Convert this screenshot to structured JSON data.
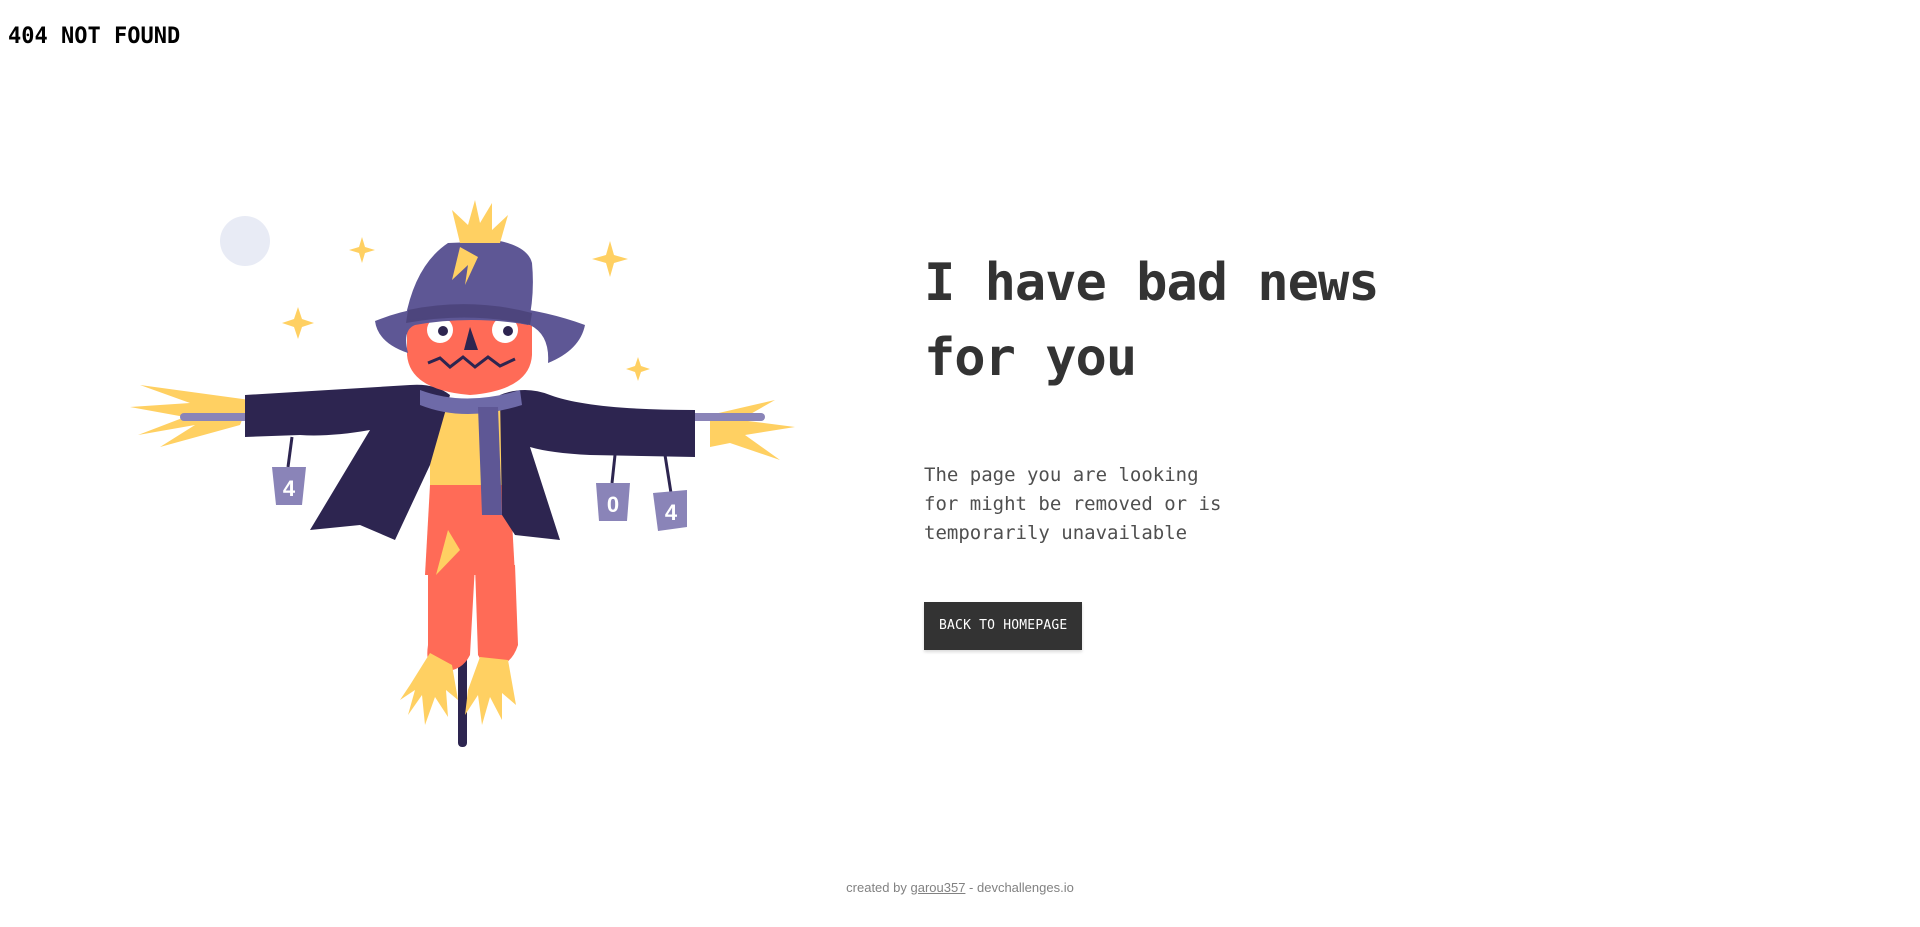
{
  "header": {
    "title": "404 NOT FOUND"
  },
  "main": {
    "headline_line1": "I have bad news",
    "headline_line2": "for you",
    "description": "The page you are looking for might be removed or is temporarily unavailable",
    "button_label": "BACK TO HOMEPAGE"
  },
  "illustration": {
    "can_labels": [
      "4",
      "0",
      "4"
    ],
    "colors": {
      "coat": "#2d2550",
      "hat": "#5e5795",
      "face": "#ff6b57",
      "straw": "#ffd062",
      "scarf": "#6e6aa8",
      "moon": "#e8ebf5"
    }
  },
  "footer": {
    "prefix": "created by ",
    "author": "garou357",
    "suffix": " - devchallenges.io"
  }
}
